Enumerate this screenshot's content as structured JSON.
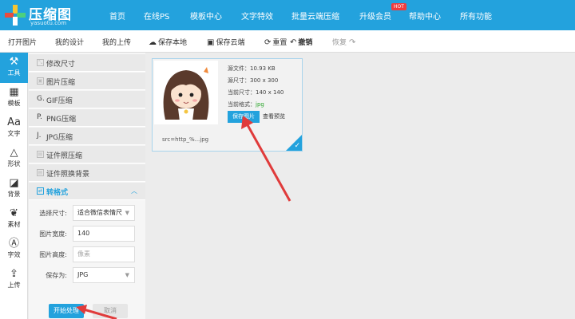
{
  "brand": {
    "name": "压缩图",
    "domain": "yasuotu.com",
    "colors": {
      "primary": "#23a2dd",
      "annotation": "#e03b3b",
      "hot": "#f03c3c"
    }
  },
  "nav": {
    "items": [
      "首页",
      "在线PS",
      "模板中心",
      "文字特效",
      "批量云端压缩",
      "升级会员",
      "帮助中心",
      "所有功能"
    ],
    "badge": "HOT"
  },
  "toolbar": {
    "open": "打开图片",
    "my_designs": "我的设计",
    "my_uploads": "我的上传",
    "save_local": "保存本地",
    "save_cloud": "保存云端",
    "reset": "重置",
    "undo": "撤销",
    "redo": "恢复"
  },
  "rail": {
    "items": [
      {
        "label": "工具",
        "icon": "toolbox-icon"
      },
      {
        "label": "模板",
        "icon": "template-icon"
      },
      {
        "label": "文字",
        "icon": "text-icon"
      },
      {
        "label": "形状",
        "icon": "shape-icon"
      },
      {
        "label": "背景",
        "icon": "background-icon"
      },
      {
        "label": "素材",
        "icon": "material-icon"
      },
      {
        "label": "字效",
        "icon": "text-effect-icon"
      },
      {
        "label": "上传",
        "icon": "upload-icon"
      }
    ]
  },
  "menu": {
    "items": [
      {
        "label": "修改尺寸",
        "icon": "resize-icon"
      },
      {
        "label": "图片压缩",
        "icon": "image-compress-icon"
      },
      {
        "label": "GIF压缩",
        "icon": "gif-icon",
        "prefix": "G."
      },
      {
        "label": "PNG压缩",
        "icon": "png-icon",
        "prefix": "P."
      },
      {
        "label": "JPG压缩",
        "icon": "jpg-icon",
        "prefix": "J."
      },
      {
        "label": "证件照压缩",
        "icon": "id-photo-icon"
      },
      {
        "label": "证件照换背景",
        "icon": "id-background-icon"
      },
      {
        "label": "转格式",
        "icon": "convert-icon"
      }
    ],
    "form": {
      "size_label": "选择尺寸:",
      "size_value": "适合微信表情尺",
      "width_label": "图片宽度:",
      "width_value": "140",
      "height_label": "图片高度:",
      "height_placeholder": "像素",
      "save_as_label": "保存为:",
      "save_as_value": "JPG"
    },
    "start_button": "开始处理",
    "cancel_button": "取消"
  },
  "canvas": {
    "file": {
      "src_size": "源文件：10.93 KB",
      "src_dims": "源尺寸：300 x 300",
      "cur_dims": "当前尺寸：140 x 140",
      "cur_format_label": "当前格式：",
      "cur_format_value": "jpg"
    },
    "save_button": "保存图片",
    "preview_link": "查看预览",
    "src": "src=http_%...jpg"
  }
}
